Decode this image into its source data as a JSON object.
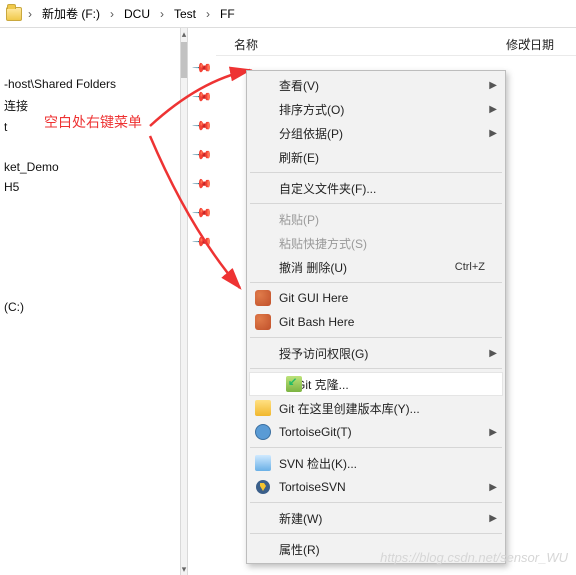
{
  "breadcrumb": [
    "新加卷 (F:)",
    "DCU",
    "Test",
    "FF"
  ],
  "columns": {
    "name": "名称",
    "modified": "修改日期"
  },
  "annotation": "空白处右键菜单",
  "left_items": [
    "",
    "",
    "-host\\Shared Folders",
    "连接",
    "t",
    "",
    "ket_Demo",
    "H5",
    "",
    "",
    "",
    "",
    "",
    "(C:)"
  ],
  "context_menu": {
    "groups": [
      [
        {
          "label": "查看(V)",
          "submenu": true
        },
        {
          "label": "排序方式(O)",
          "submenu": true
        },
        {
          "label": "分组依据(P)",
          "submenu": true
        },
        {
          "label": "刷新(E)"
        }
      ],
      [
        {
          "label": "自定义文件夹(F)..."
        }
      ],
      [
        {
          "label": "粘贴(P)",
          "disabled": true
        },
        {
          "label": "粘贴快捷方式(S)",
          "disabled": true
        },
        {
          "label": "撤消 删除(U)",
          "shortcut": "Ctrl+Z"
        }
      ],
      [
        {
          "label": "Git GUI Here",
          "icon": "git"
        },
        {
          "label": "Git Bash Here",
          "icon": "git"
        }
      ],
      [
        {
          "label": "授予访问权限(G)",
          "submenu": true
        }
      ],
      [
        {
          "label": "Git 克隆...",
          "icon": "gitclone",
          "highlight": true
        },
        {
          "label": "Git 在这里创建版本库(Y)...",
          "icon": "gitrepo"
        },
        {
          "label": "TortoiseGit(T)",
          "icon": "tgit",
          "submenu": true
        }
      ],
      [
        {
          "label": "SVN 检出(K)...",
          "icon": "svn"
        },
        {
          "label": "TortoiseSVN",
          "icon": "tsvn",
          "submenu": true
        }
      ],
      [
        {
          "label": "新建(W)",
          "submenu": true
        }
      ],
      [
        {
          "label": "属性(R)"
        }
      ]
    ]
  },
  "watermark": "https://blog.csdn.net/sensor_WU"
}
